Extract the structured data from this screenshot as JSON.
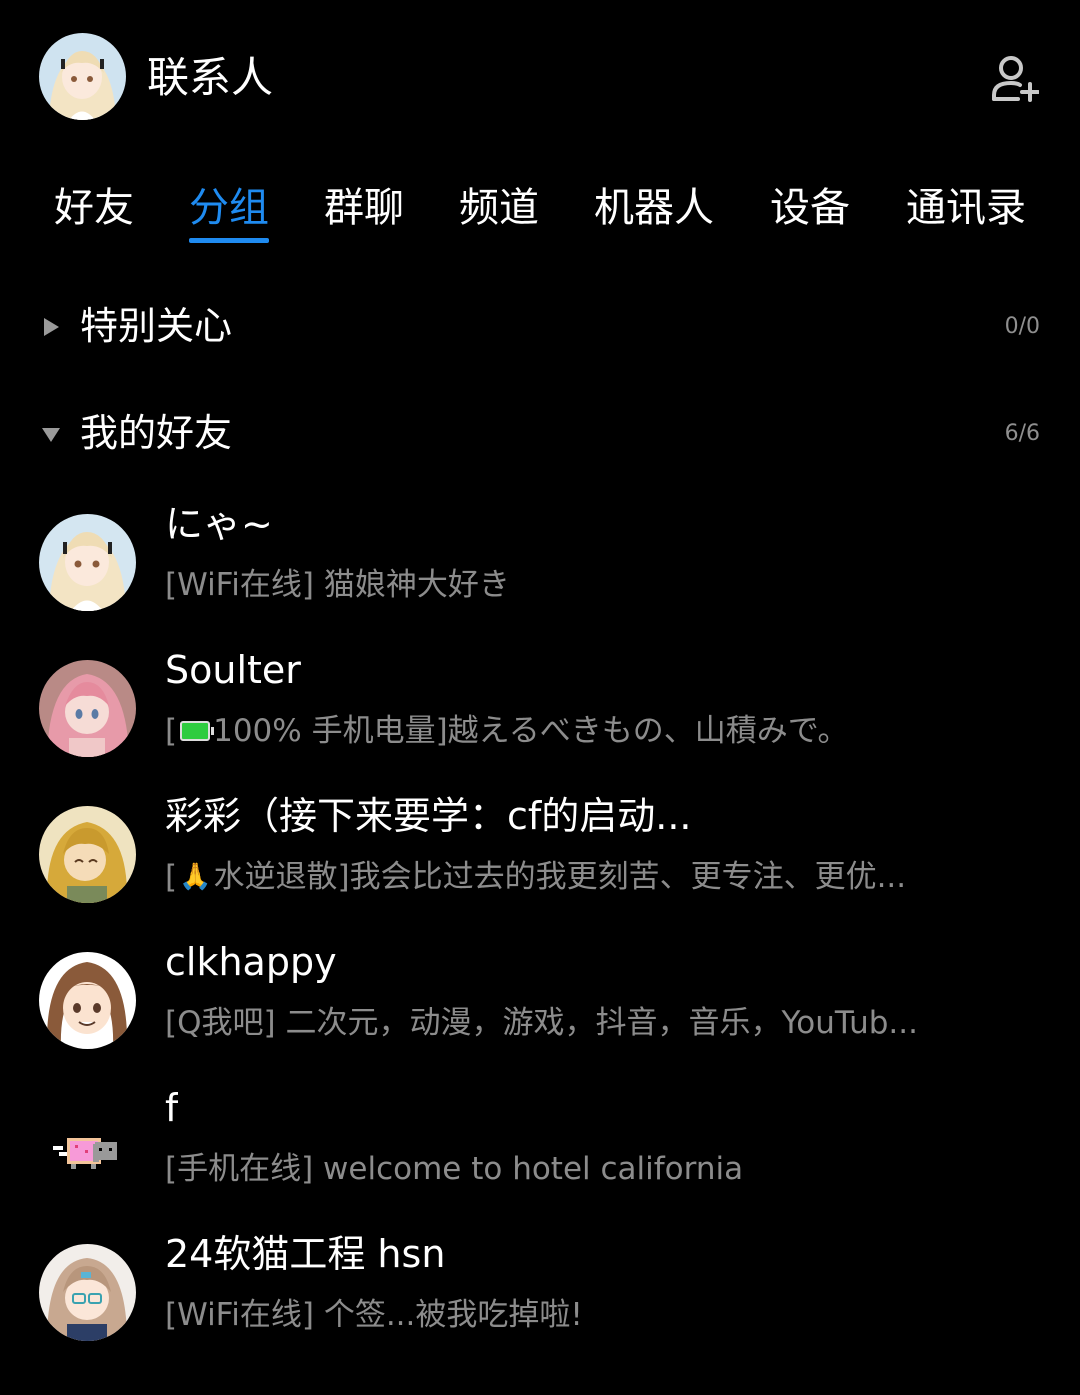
{
  "header": {
    "title": "联系人",
    "add_friend_icon": "add-person-icon"
  },
  "tabs": [
    {
      "label": "好友",
      "active": false
    },
    {
      "label": "分组",
      "active": true
    },
    {
      "label": "群聊",
      "active": false
    },
    {
      "label": "频道",
      "active": false
    },
    {
      "label": "机器人",
      "active": false
    },
    {
      "label": "设备",
      "active": false
    },
    {
      "label": "通讯录",
      "active": false
    }
  ],
  "groups": [
    {
      "name": "特别关心",
      "count": "0/0",
      "expanded": false
    },
    {
      "name": "我的好友",
      "count": "6/6",
      "expanded": true
    }
  ],
  "friends": [
    {
      "name": "にゃ~",
      "status": "[WiFi在线] 猫娘神大好き"
    },
    {
      "name": "Soulter",
      "status_prefix": "[",
      "status_icon": "battery-full-icon",
      "status": "100% 手机电量]越えるべきもの、山積みで。"
    },
    {
      "name": "彩彩（接下来要学：cf的启动...",
      "status_prefix": "[",
      "status_icon": "folded-hands-icon",
      "status": "水逆退散]我会比过去的我更刻苦、更专注、更优..."
    },
    {
      "name": "clkhappy",
      "status": "[Q我吧] 二次元，动漫，游戏，抖音，音乐，YouTub..."
    },
    {
      "name": "f",
      "status": "[手机在线] welcome to hotel california"
    },
    {
      "name": "24软猫工程 hsn",
      "status": "[WiFi在线] 个签...被我吃掉啦!"
    }
  ],
  "colors": {
    "accent": "#1f8bf0",
    "background": "#000000",
    "secondary_text": "#8c8c8c"
  }
}
